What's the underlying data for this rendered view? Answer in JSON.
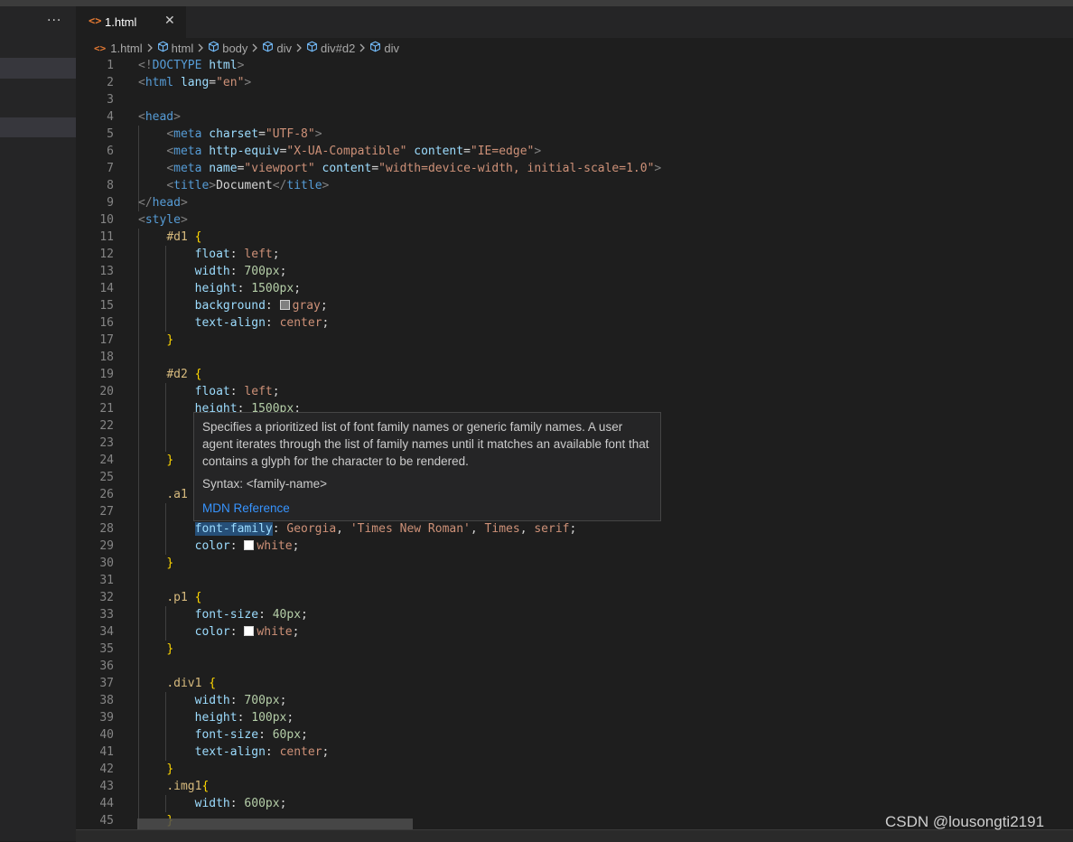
{
  "tab": {
    "label": "1.html",
    "file_icon": "<>",
    "close_icon": "✕"
  },
  "sidebar": {
    "more_icon": "···"
  },
  "breadcrumb": [
    "1.html",
    "html",
    "body",
    "div",
    "div#d2",
    "div"
  ],
  "lines": [
    {
      "n": "1",
      "t": [
        [
          "ang",
          "<!"
        ],
        [
          "tag",
          "DOCTYPE"
        ],
        [
          "txt",
          " "
        ],
        [
          "attr",
          "html"
        ],
        [
          "ang",
          ">"
        ]
      ]
    },
    {
      "n": "2",
      "t": [
        [
          "ang",
          "<"
        ],
        [
          "tag",
          "html"
        ],
        [
          "txt",
          " "
        ],
        [
          "attr",
          "lang"
        ],
        [
          "pun",
          "="
        ],
        [
          "str",
          "\"en\""
        ],
        [
          "ang",
          ">"
        ]
      ]
    },
    {
      "n": "3",
      "t": []
    },
    {
      "n": "4",
      "t": [
        [
          "ang",
          "<"
        ],
        [
          "tag",
          "head"
        ],
        [
          "ang",
          ">"
        ]
      ]
    },
    {
      "n": "5",
      "t": [
        [
          "txt",
          "    "
        ],
        [
          "ang",
          "<"
        ],
        [
          "tag",
          "meta"
        ],
        [
          "txt",
          " "
        ],
        [
          "attr",
          "charset"
        ],
        [
          "pun",
          "="
        ],
        [
          "str",
          "\"UTF-8\""
        ],
        [
          "ang",
          ">"
        ]
      ]
    },
    {
      "n": "6",
      "t": [
        [
          "txt",
          "    "
        ],
        [
          "ang",
          "<"
        ],
        [
          "tag",
          "meta"
        ],
        [
          "txt",
          " "
        ],
        [
          "attr",
          "http-equiv"
        ],
        [
          "pun",
          "="
        ],
        [
          "str",
          "\"X-UA-Compatible\""
        ],
        [
          "txt",
          " "
        ],
        [
          "attr",
          "content"
        ],
        [
          "pun",
          "="
        ],
        [
          "str",
          "\"IE=edge\""
        ],
        [
          "ang",
          ">"
        ]
      ]
    },
    {
      "n": "7",
      "t": [
        [
          "txt",
          "    "
        ],
        [
          "ang",
          "<"
        ],
        [
          "tag",
          "meta"
        ],
        [
          "txt",
          " "
        ],
        [
          "attr",
          "name"
        ],
        [
          "pun",
          "="
        ],
        [
          "str",
          "\"viewport\""
        ],
        [
          "txt",
          " "
        ],
        [
          "attr",
          "content"
        ],
        [
          "pun",
          "="
        ],
        [
          "str",
          "\"width=device-width, initial-scale=1.0\""
        ],
        [
          "ang",
          ">"
        ]
      ]
    },
    {
      "n": "8",
      "t": [
        [
          "txt",
          "    "
        ],
        [
          "ang",
          "<"
        ],
        [
          "tag",
          "title"
        ],
        [
          "ang",
          ">"
        ],
        [
          "txt",
          "Document"
        ],
        [
          "ang",
          "</"
        ],
        [
          "tag",
          "title"
        ],
        [
          "ang",
          ">"
        ]
      ]
    },
    {
      "n": "9",
      "t": [
        [
          "ang",
          "</"
        ],
        [
          "tag",
          "head"
        ],
        [
          "ang",
          ">"
        ]
      ]
    },
    {
      "n": "10",
      "t": [
        [
          "ang",
          "<"
        ],
        [
          "tag",
          "style"
        ],
        [
          "ang",
          ">"
        ]
      ]
    },
    {
      "n": "11",
      "t": [
        [
          "txt",
          "    "
        ],
        [
          "sel",
          "#d1"
        ],
        [
          "txt",
          " "
        ],
        [
          "br",
          "{"
        ]
      ]
    },
    {
      "n": "12",
      "t": [
        [
          "txt",
          "        "
        ],
        [
          "prop",
          "float"
        ],
        [
          "pun",
          ": "
        ],
        [
          "val",
          "left"
        ],
        [
          "pun",
          ";"
        ]
      ]
    },
    {
      "n": "13",
      "t": [
        [
          "txt",
          "        "
        ],
        [
          "prop",
          "width"
        ],
        [
          "pun",
          ": "
        ],
        [
          "num",
          "700px"
        ],
        [
          "pun",
          ";"
        ]
      ]
    },
    {
      "n": "14",
      "t": [
        [
          "txt",
          "        "
        ],
        [
          "prop",
          "height"
        ],
        [
          "pun",
          ": "
        ],
        [
          "num",
          "1500px"
        ],
        [
          "pun",
          ";"
        ]
      ]
    },
    {
      "n": "15",
      "t": [
        [
          "txt",
          "        "
        ],
        [
          "prop",
          "background"
        ],
        [
          "pun",
          ": "
        ],
        [
          "swatch",
          "#808080"
        ],
        [
          "val",
          "gray"
        ],
        [
          "pun",
          ";"
        ]
      ]
    },
    {
      "n": "16",
      "t": [
        [
          "txt",
          "        "
        ],
        [
          "prop",
          "text-align"
        ],
        [
          "pun",
          ": "
        ],
        [
          "val",
          "center"
        ],
        [
          "pun",
          ";"
        ]
      ]
    },
    {
      "n": "17",
      "t": [
        [
          "txt",
          "    "
        ],
        [
          "br",
          "}"
        ]
      ]
    },
    {
      "n": "18",
      "t": []
    },
    {
      "n": "19",
      "t": [
        [
          "txt",
          "    "
        ],
        [
          "sel",
          "#d2"
        ],
        [
          "txt",
          " "
        ],
        [
          "br",
          "{"
        ]
      ]
    },
    {
      "n": "20",
      "t": [
        [
          "txt",
          "        "
        ],
        [
          "prop",
          "float"
        ],
        [
          "pun",
          ": "
        ],
        [
          "val",
          "left"
        ],
        [
          "pun",
          ";"
        ]
      ]
    },
    {
      "n": "21",
      "t": [
        [
          "txt",
          "        "
        ],
        [
          "prop",
          "height"
        ],
        [
          "pun",
          ": "
        ],
        [
          "num",
          "1500px"
        ],
        [
          "pun",
          ";"
        ]
      ]
    },
    {
      "n": "22",
      "t": []
    },
    {
      "n": "23",
      "t": []
    },
    {
      "n": "24",
      "t": [
        [
          "txt",
          "    "
        ],
        [
          "br",
          "}"
        ]
      ]
    },
    {
      "n": "25",
      "t": []
    },
    {
      "n": "26",
      "t": [
        [
          "txt",
          "    "
        ],
        [
          "sel",
          ".a1"
        ]
      ]
    },
    {
      "n": "27",
      "t": []
    },
    {
      "n": "28",
      "t": [
        [
          "txt",
          "        "
        ],
        [
          "prophl",
          "font-family"
        ],
        [
          "pun",
          ": "
        ],
        [
          "val",
          "Georgia"
        ],
        [
          "pun",
          ", "
        ],
        [
          "str",
          "'Times New Roman'"
        ],
        [
          "pun",
          ", "
        ],
        [
          "val",
          "Times"
        ],
        [
          "pun",
          ", "
        ],
        [
          "val",
          "serif"
        ],
        [
          "pun",
          ";"
        ]
      ]
    },
    {
      "n": "29",
      "t": [
        [
          "txt",
          "        "
        ],
        [
          "prop",
          "color"
        ],
        [
          "pun",
          ": "
        ],
        [
          "swatch",
          "#ffffff"
        ],
        [
          "val",
          "white"
        ],
        [
          "pun",
          ";"
        ]
      ]
    },
    {
      "n": "30",
      "t": [
        [
          "txt",
          "    "
        ],
        [
          "br",
          "}"
        ]
      ]
    },
    {
      "n": "31",
      "t": []
    },
    {
      "n": "32",
      "t": [
        [
          "txt",
          "    "
        ],
        [
          "sel",
          ".p1"
        ],
        [
          "txt",
          " "
        ],
        [
          "br",
          "{"
        ]
      ]
    },
    {
      "n": "33",
      "t": [
        [
          "txt",
          "        "
        ],
        [
          "prop",
          "font-size"
        ],
        [
          "pun",
          ": "
        ],
        [
          "num",
          "40px"
        ],
        [
          "pun",
          ";"
        ]
      ]
    },
    {
      "n": "34",
      "t": [
        [
          "txt",
          "        "
        ],
        [
          "prop",
          "color"
        ],
        [
          "pun",
          ": "
        ],
        [
          "swatch",
          "#ffffff"
        ],
        [
          "val",
          "white"
        ],
        [
          "pun",
          ";"
        ]
      ]
    },
    {
      "n": "35",
      "t": [
        [
          "txt",
          "    "
        ],
        [
          "br",
          "}"
        ]
      ]
    },
    {
      "n": "36",
      "t": []
    },
    {
      "n": "37",
      "t": [
        [
          "txt",
          "    "
        ],
        [
          "sel",
          ".div1"
        ],
        [
          "txt",
          " "
        ],
        [
          "br",
          "{"
        ]
      ]
    },
    {
      "n": "38",
      "t": [
        [
          "txt",
          "        "
        ],
        [
          "prop",
          "width"
        ],
        [
          "pun",
          ": "
        ],
        [
          "num",
          "700px"
        ],
        [
          "pun",
          ";"
        ]
      ]
    },
    {
      "n": "39",
      "t": [
        [
          "txt",
          "        "
        ],
        [
          "prop",
          "height"
        ],
        [
          "pun",
          ": "
        ],
        [
          "num",
          "100px"
        ],
        [
          "pun",
          ";"
        ]
      ]
    },
    {
      "n": "40",
      "t": [
        [
          "txt",
          "        "
        ],
        [
          "prop",
          "font-size"
        ],
        [
          "pun",
          ": "
        ],
        [
          "num",
          "60px"
        ],
        [
          "pun",
          ";"
        ]
      ]
    },
    {
      "n": "41",
      "t": [
        [
          "txt",
          "        "
        ],
        [
          "prop",
          "text-align"
        ],
        [
          "pun",
          ": "
        ],
        [
          "val",
          "center"
        ],
        [
          "pun",
          ";"
        ]
      ]
    },
    {
      "n": "42",
      "t": [
        [
          "txt",
          "    "
        ],
        [
          "br",
          "}"
        ]
      ]
    },
    {
      "n": "43",
      "t": [
        [
          "txt",
          "    "
        ],
        [
          "sel",
          ".img1"
        ],
        [
          "br",
          "{"
        ]
      ]
    },
    {
      "n": "44",
      "t": [
        [
          "txt",
          "        "
        ],
        [
          "prop",
          "width"
        ],
        [
          "pun",
          ": "
        ],
        [
          "num",
          "600px"
        ],
        [
          "pun",
          ";"
        ]
      ]
    },
    {
      "n": "45",
      "t": [
        [
          "txt",
          "    "
        ],
        [
          "br",
          "}"
        ]
      ]
    }
  ],
  "hover": {
    "description": "Specifies a prioritized list of font family names or generic family names. A user agent iterates through the list of family names until it matches an available font that contains a glyph for the character to be rendered.",
    "syntax": "Syntax: <family-name>",
    "link": "MDN Reference"
  },
  "watermark": "CSDN @lousongti2191"
}
